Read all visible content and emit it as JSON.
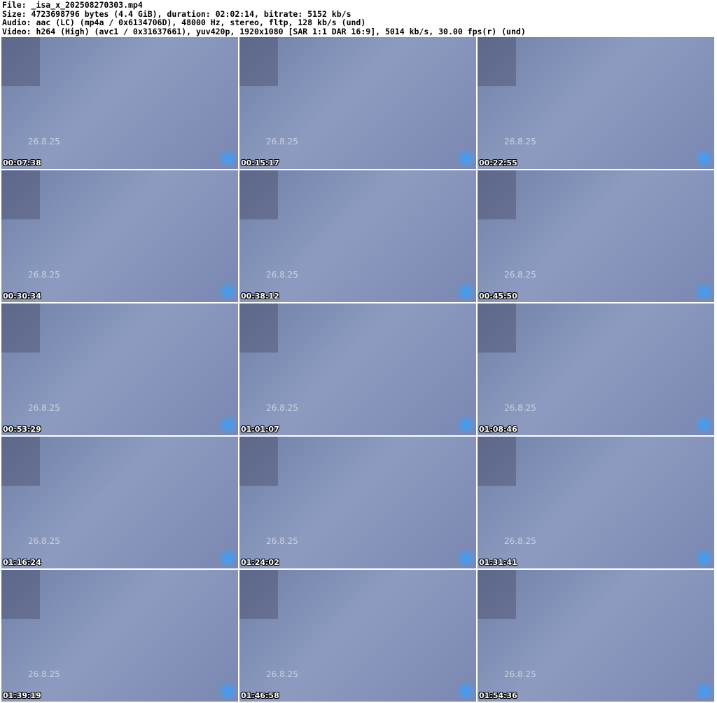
{
  "header": {
    "file": "File: _isa_x_202508270303.mp4",
    "size": "Size: 4723698796 bytes (4.4 GiB), duration: 02:02:14, bitrate: 5152 kb/s",
    "audio": "Audio: aac (LC) (mp4a / 0x6134706D), 48000 Hz, stereo, fltp, 128 kb/s (und)",
    "video": "Video: h264 (High) (avc1 / 0x31637661), yuv420p, 1920x1080 [SAR 1:1 DAR 16:9], 5014 kb/s, 30.00 fps(r) (und)"
  },
  "watermark": "26.8.25",
  "thumbnails": [
    {
      "timestamp": "00:07:38"
    },
    {
      "timestamp": "00:15:17"
    },
    {
      "timestamp": "00:22:55"
    },
    {
      "timestamp": "00:30:34"
    },
    {
      "timestamp": "00:38:12"
    },
    {
      "timestamp": "00:45:50"
    },
    {
      "timestamp": "00:53:29"
    },
    {
      "timestamp": "01:01:07"
    },
    {
      "timestamp": "01:08:46"
    },
    {
      "timestamp": "01:16:24"
    },
    {
      "timestamp": "01:24:02"
    },
    {
      "timestamp": "01:31:41"
    },
    {
      "timestamp": "01:39:19"
    },
    {
      "timestamp": "01:46:58"
    },
    {
      "timestamp": "01:54:36"
    }
  ]
}
